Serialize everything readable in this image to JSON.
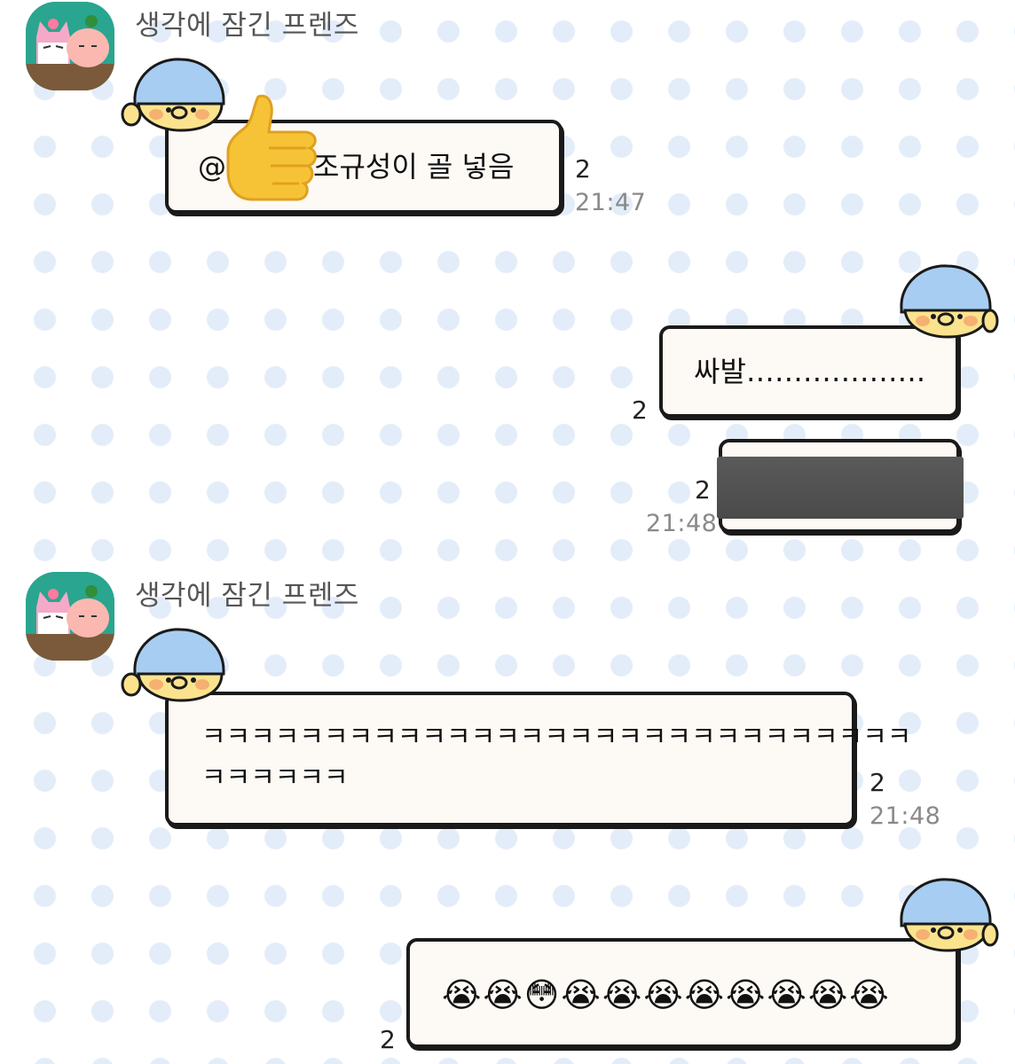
{
  "messages": [
    {
      "sender": "생각에 잠긴 프렌즈",
      "prefix": "@",
      "text": "조규성이 골 넣음",
      "mention_icon": "thumbs-up-icon",
      "read_count": "2",
      "time": "21:47"
    },
    {
      "outgoing": true,
      "text": "싸발……………….",
      "read_count": "2"
    },
    {
      "outgoing": true,
      "redacted": true,
      "read_count": "2",
      "time": "21:48"
    },
    {
      "sender": "생각에 잠긴 프렌즈",
      "line1": "ㅋㅋㅋㅋㅋㅋㅋㅋㅋㅋㅋㅋㅋㅋㅋㅋㅋㅋㅋㅋㅋㅋㅋㅋㅋㅋㅋㅋㅋ",
      "line2": "ㅋㅋㅋㅋㅋㅋ",
      "read_count": "2",
      "time": "21:48"
    },
    {
      "outgoing": true,
      "text": "😭😭😳😭😭😭😭😭😭😭😭",
      "read_count": "2"
    }
  ],
  "colors": {
    "background": "#ffffff",
    "dots": "#e3edf9",
    "bubble": "#fdf9f5",
    "bubble_border": "#1a1a1a",
    "avatar_bg": "#2aa58f",
    "chick_hat": "#a8cdf2",
    "chick_face": "#fbe38e",
    "redaction": "#4f4f4f"
  },
  "icons": {
    "avatar": "friends-avatar-icon",
    "bubble_sticker": "chick-beanie-icon"
  }
}
